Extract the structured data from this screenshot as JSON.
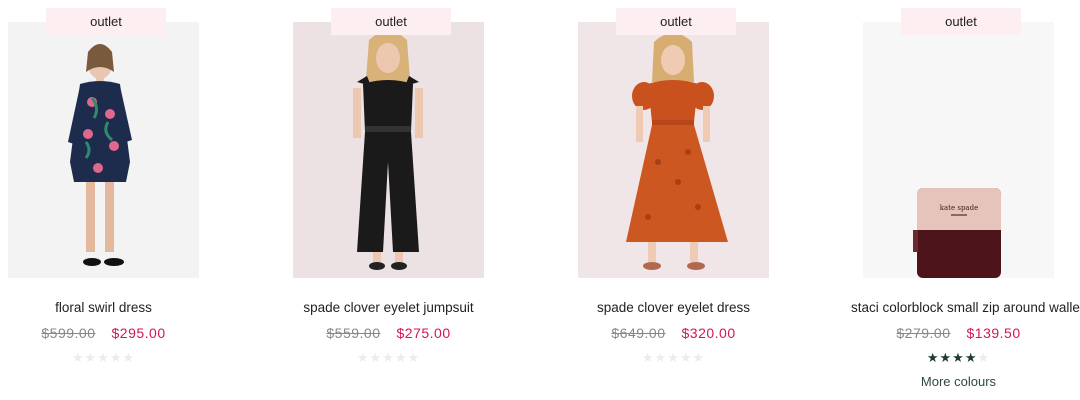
{
  "products": [
    {
      "badge": "outlet",
      "title": "floral swirl dress",
      "was_price": "$599.00",
      "now_price": "$295.00",
      "rating": 0,
      "more_colours": ""
    },
    {
      "badge": "outlet",
      "title": "spade clover eyelet jumpsuit",
      "was_price": "$559.00",
      "now_price": "$275.00",
      "rating": 0,
      "more_colours": ""
    },
    {
      "badge": "outlet",
      "title": "spade clover eyelet dress",
      "was_price": "$649.00",
      "now_price": "$320.00",
      "rating": 0,
      "more_colours": ""
    },
    {
      "badge": "outlet",
      "title": "staci colorblock small zip around wallet",
      "was_price": "$279.00",
      "now_price": "$139.50",
      "rating": 4,
      "more_colours": "More colours",
      "wallet_logo_text": "kate spade"
    }
  ],
  "colors": {
    "sale_price": "#d3174f",
    "badge_bg": "#fdeef2",
    "star_filled": "#1f3b2c",
    "star_empty": "#ececec"
  }
}
